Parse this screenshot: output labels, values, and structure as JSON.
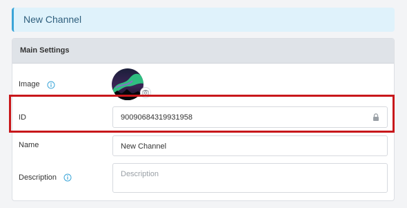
{
  "banner": {
    "title": "New Channel"
  },
  "main_settings": {
    "title": "Main Settings",
    "image": {
      "label": "Image",
      "info_icon": "info-icon",
      "camera_icon": "camera-icon"
    },
    "id": {
      "label": "ID",
      "value": "90090684319931958",
      "lock_icon": "lock-icon"
    },
    "name": {
      "label": "Name",
      "value": "New Channel"
    },
    "description": {
      "label": "Description",
      "placeholder": "Description",
      "value": "",
      "info_icon": "info-icon"
    }
  },
  "colors": {
    "banner_bg": "#dff2fb",
    "banner_accent": "#3aa5d8",
    "header_bg": "#dfe3e8",
    "highlight": "#c8171b"
  }
}
